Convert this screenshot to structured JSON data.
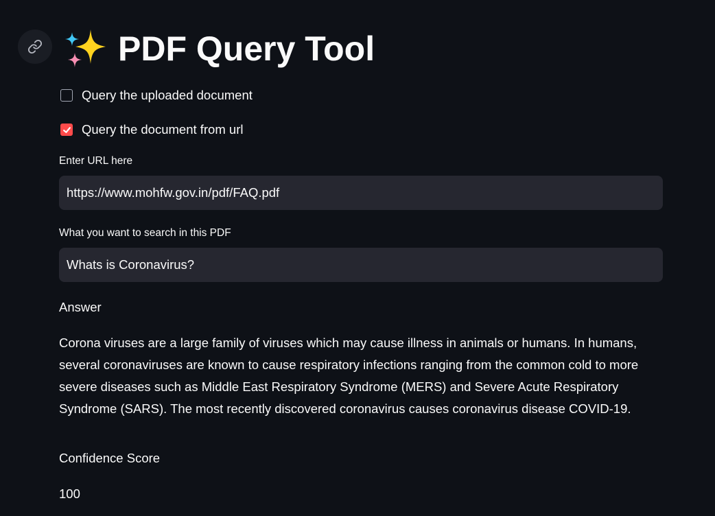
{
  "header": {
    "title": "PDF Query Tool",
    "title_icon": "sparkles-emoji",
    "anchor_icon": "link-icon"
  },
  "options": [
    {
      "label": "Query the uploaded document",
      "checked": false
    },
    {
      "label": "Query the document from url",
      "checked": true
    }
  ],
  "url_field": {
    "label": "Enter URL here",
    "value": "https://www.mohfw.gov.in/pdf/FAQ.pdf"
  },
  "search_field": {
    "label": "What you want to search in this PDF",
    "value": "Whats is Coronavirus?"
  },
  "answer": {
    "heading": "Answer",
    "text": "Corona viruses are a large family of viruses which may cause illness in animals or humans. In humans, several coronaviruses are known to cause respiratory infections ranging from the common cold to more severe diseases such as Middle East Respiratory Syndrome (MERS) and Severe Acute Respiratory Syndrome (SARS). The most recently discovered coronavirus causes coronavirus disease COVID-19."
  },
  "confidence": {
    "heading": "Confidence Score",
    "value": "100"
  },
  "colors": {
    "background": "#0e1117",
    "input_background": "#262730",
    "accent": "#ff4b4b",
    "text": "#fafafa"
  }
}
